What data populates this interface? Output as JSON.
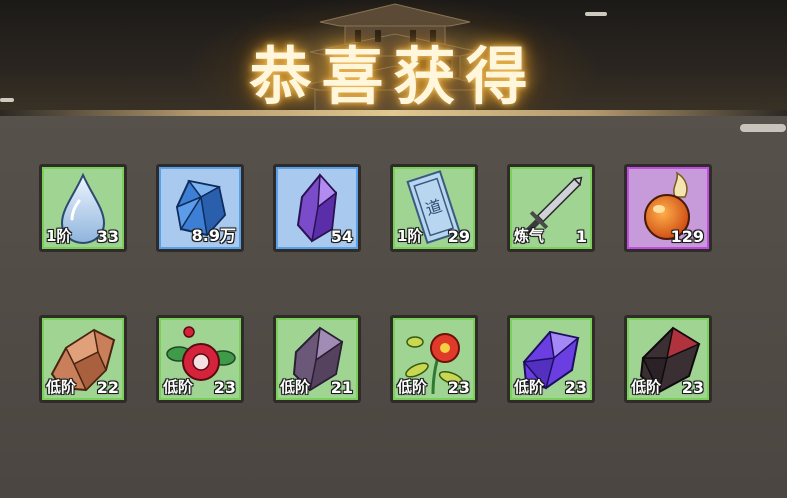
{
  "title": "恭喜获得",
  "rows": [
    [
      {
        "icon": "water-drop-icon",
        "tier": "1阶",
        "count": "33",
        "rarity": "green"
      },
      {
        "icon": "blue-crystal-icon",
        "tier": "",
        "count": "8.9万",
        "rarity": "blue"
      },
      {
        "icon": "purple-crystal-icon",
        "tier": "",
        "count": "54",
        "rarity": "blue"
      },
      {
        "icon": "scroll-talisman-icon",
        "tier": "1阶",
        "count": "29",
        "rarity": "green"
      },
      {
        "icon": "sword-icon",
        "tier": "炼气",
        "count": "1",
        "rarity": "green"
      },
      {
        "icon": "fire-orb-icon",
        "tier": "",
        "count": "129",
        "rarity": "purple"
      }
    ],
    [
      {
        "icon": "copper-ore-icon",
        "tier": "低阶",
        "count": "22",
        "rarity": "green"
      },
      {
        "icon": "red-flower-icon",
        "tier": "低阶",
        "count": "23",
        "rarity": "green"
      },
      {
        "icon": "dark-crystal-icon",
        "tier": "低阶",
        "count": "21",
        "rarity": "green"
      },
      {
        "icon": "red-blossom-herb-icon",
        "tier": "低阶",
        "count": "23",
        "rarity": "green"
      },
      {
        "icon": "violet-crystal-icon",
        "tier": "低阶",
        "count": "23",
        "rarity": "green"
      },
      {
        "icon": "obsidian-shard-icon",
        "tier": "低阶",
        "count": "23",
        "rarity": "green"
      }
    ]
  ],
  "colors": {
    "green_tile": "#9fd493",
    "blue_tile": "#a9c9ef",
    "purple_tile": "#c79ad9",
    "title_glow": "#f0c060"
  }
}
